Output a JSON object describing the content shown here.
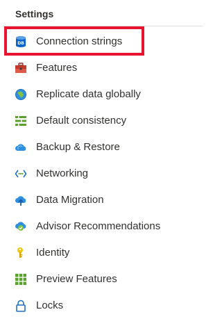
{
  "section": {
    "title": "Settings"
  },
  "highlight_color": "#e8132f",
  "items": [
    {
      "label": "Connection strings",
      "icon": "database-icon",
      "selected": true
    },
    {
      "label": "Features",
      "icon": "toolbox-icon"
    },
    {
      "label": "Replicate data globally",
      "icon": "globe-icon"
    },
    {
      "label": "Default consistency",
      "icon": "list-bars-icon"
    },
    {
      "label": "Backup & Restore",
      "icon": "cloud-backup-icon"
    },
    {
      "label": "Networking",
      "icon": "network-icon"
    },
    {
      "label": "Data Migration",
      "icon": "cloud-upload-icon"
    },
    {
      "label": "Advisor Recommendations",
      "icon": "advisor-icon"
    },
    {
      "label": "Identity",
      "icon": "key-icon"
    },
    {
      "label": "Preview Features",
      "icon": "grid-icon"
    },
    {
      "label": "Locks",
      "icon": "lock-icon"
    }
  ]
}
